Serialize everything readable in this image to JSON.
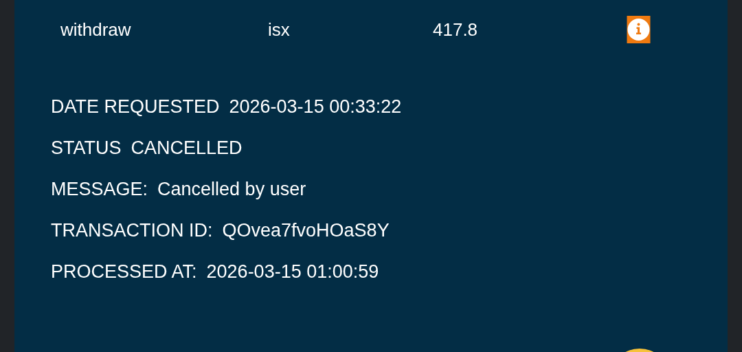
{
  "transaction": {
    "type": "withdraw",
    "asset": "isx",
    "amount": "417.8"
  },
  "details": [
    {
      "label": "DATE REQUESTED",
      "value": "2026-03-15 00:33:22"
    },
    {
      "label": "STATUS",
      "value": "CANCELLED"
    },
    {
      "label": "MESSAGE:",
      "value": "Cancelled by user"
    },
    {
      "label": "TRANSACTION ID:",
      "value": "QOvea7fvoHOaS8Y"
    },
    {
      "label": "PROCESSED AT:",
      "value": "2026-03-15 01:00:59"
    }
  ]
}
